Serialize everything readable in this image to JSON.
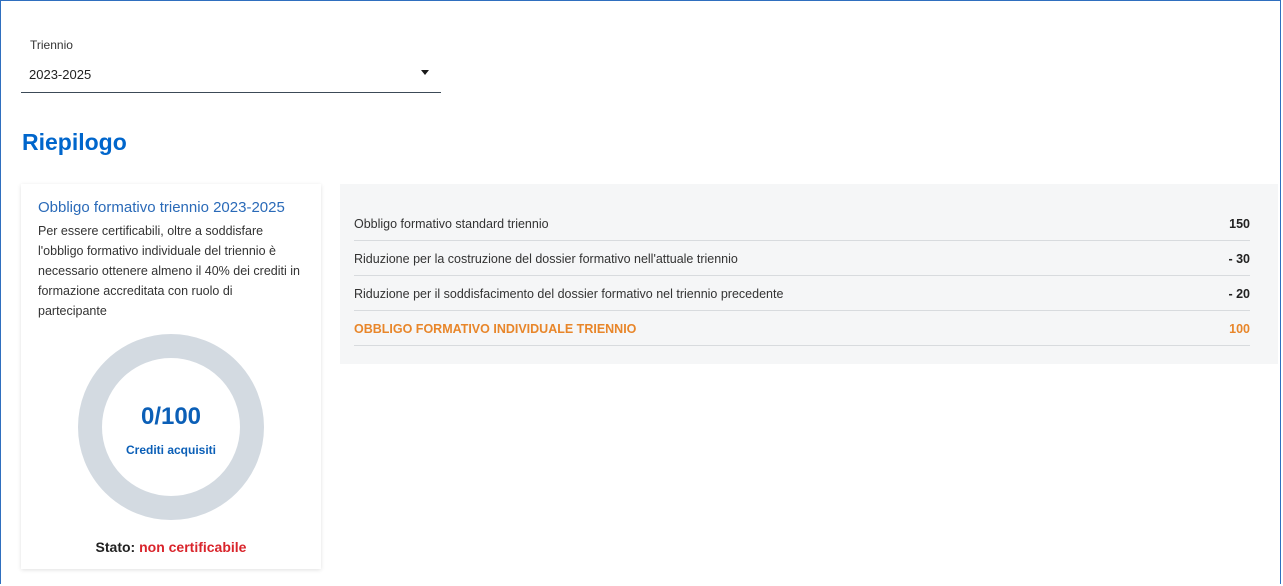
{
  "filter": {
    "label": "Triennio",
    "selected": "2023-2025"
  },
  "section_title": "Riepilogo",
  "summary_card": {
    "title": "Obbligo formativo triennio 2023-2025",
    "description": "Per essere certificabili, oltre a soddisfare l'obbligo formativo individuale del triennio è necessario ottenere almeno il 40% dei crediti in formazione accreditata con ruolo di partecipante",
    "progress_value": "0/100",
    "progress_fraction": 0,
    "progress_caption": "Crediti acquisiti",
    "status_label": "Stato:",
    "status_value": "non certificabile"
  },
  "breakdown": {
    "rows": [
      {
        "label": "Obbligo formativo standard triennio",
        "value": "150"
      },
      {
        "label": "Riduzione per la costruzione del dossier formativo nell'attuale triennio",
        "value": "- 30"
      },
      {
        "label": "Riduzione per il soddisfacimento del dossier formativo nel triennio precedente",
        "value": "- 20"
      },
      {
        "label": "OBBLIGO FORMATIVO INDIVIDUALE TRIENNIO",
        "value": "100"
      }
    ]
  },
  "colors": {
    "accent": "#0066cc",
    "status_negative": "#d9242b",
    "total_highlight": "#e8862a",
    "donut_track": "#d3dae1"
  }
}
